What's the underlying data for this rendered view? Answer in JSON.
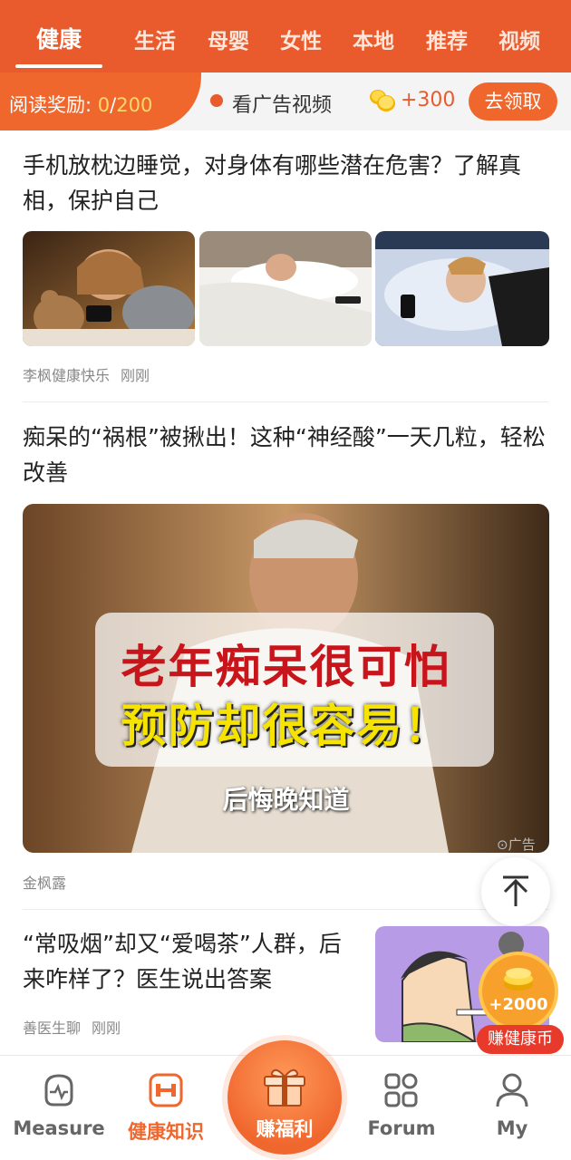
{
  "tabs": [
    "健康",
    "生活",
    "母婴",
    "女性",
    "本地",
    "推荐",
    "视频"
  ],
  "reward": {
    "label": "阅读奖励:",
    "current": "0",
    "separator": "/",
    "total": "200",
    "ad_text": "看广告视频",
    "coins": "+300",
    "claim_button": "去领取"
  },
  "articles": [
    {
      "title": "手机放枕边睡觉，对身体有哪些潜在危害？了解真相，保护自己",
      "author": "李枫健康快乐",
      "time": "刚刚"
    },
    {
      "title": "痴呆的“祸根”被揪出！这种“神经酸”一天几粒，轻松改善",
      "image_text_line1": "老年痴呆很可怕",
      "image_text_line2": "预防却很容易！",
      "image_caption": "后悔晚知道",
      "author": "金枫露",
      "ad_label": "广告"
    },
    {
      "title": "“常吸烟”却又“爱喝茶”人群，后来咋样了？医生说出答案",
      "author": "善医生聊",
      "time": "刚刚"
    }
  ],
  "floating_coin": {
    "amount": "+2000",
    "badge": "赚健康币"
  },
  "bottom_nav": {
    "items": [
      {
        "label": "Measure",
        "icon": "heart-monitor-icon"
      },
      {
        "label": "健康知识",
        "icon": "dumbbell-icon"
      },
      {
        "label": "赚福利",
        "icon": "gift-icon"
      },
      {
        "label": "Forum",
        "icon": "grid-icon"
      },
      {
        "label": "My",
        "icon": "user-icon"
      }
    ]
  },
  "colors": {
    "accent": "#e95a2c",
    "accent_light": "#f0672e",
    "coin_yellow": "#ffd76b"
  }
}
